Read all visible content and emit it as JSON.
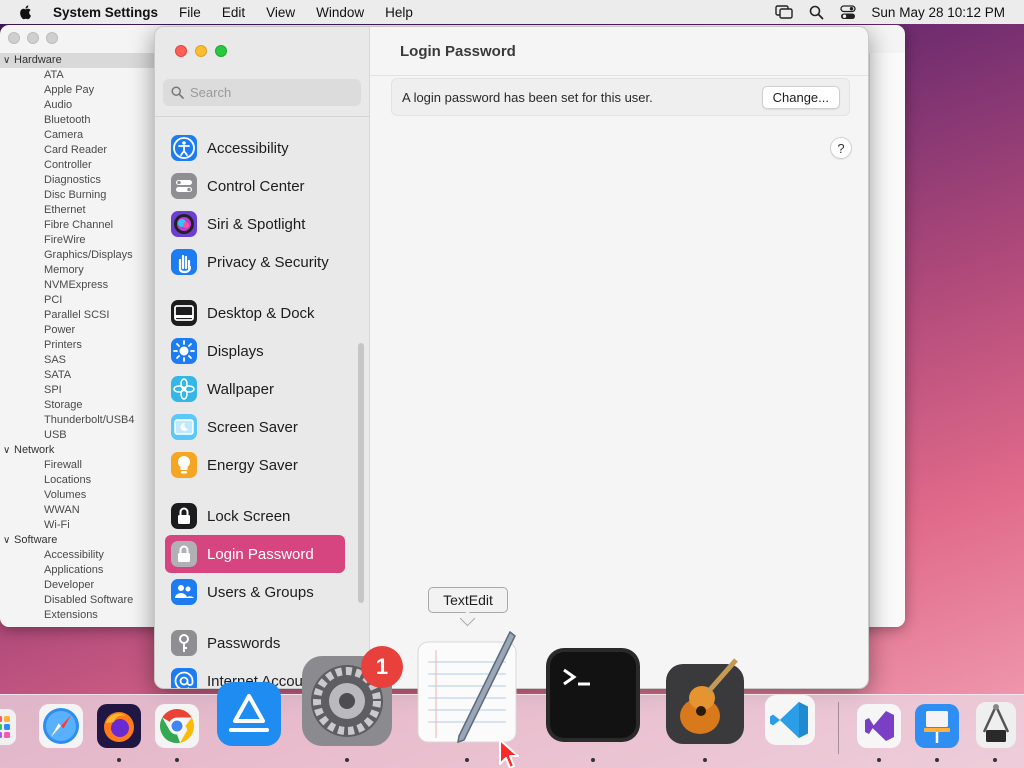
{
  "menubar": {
    "app_name": "System Settings",
    "menus": [
      "File",
      "Edit",
      "View",
      "Window",
      "Help"
    ],
    "clock": "Sun May 28  10:12 PM"
  },
  "sysinfo": {
    "categories": [
      {
        "label": "Hardware",
        "items": [
          "ATA",
          "Apple Pay",
          "Audio",
          "Bluetooth",
          "Camera",
          "Card Reader",
          "Controller",
          "Diagnostics",
          "Disc Burning",
          "Ethernet",
          "Fibre Channel",
          "FireWire",
          "Graphics/Displays",
          "Memory",
          "NVMExpress",
          "PCI",
          "Parallel SCSI",
          "Power",
          "Printers",
          "SAS",
          "SATA",
          "SPI",
          "Storage",
          "Thunderbolt/USB4",
          "USB"
        ]
      },
      {
        "label": "Network",
        "items": [
          "Firewall",
          "Locations",
          "Volumes",
          "WWAN",
          "Wi-Fi"
        ]
      },
      {
        "label": "Software",
        "items": [
          "Accessibility",
          "Applications",
          "Developer",
          "Disabled Software",
          "Extensions"
        ]
      }
    ]
  },
  "settings": {
    "search_placeholder": "Search",
    "sidebar_items": [
      {
        "label": "Accessibility",
        "icon": "accessibility-icon",
        "color": "#1e7cf2"
      },
      {
        "label": "Control Center",
        "icon": "control-center-icon",
        "color": "#8e8e93"
      },
      {
        "label": "Siri & Spotlight",
        "icon": "siri-icon",
        "color": "#6b3fd1"
      },
      {
        "label": "Privacy & Security",
        "icon": "hand-icon",
        "color": "#1e7cf2"
      },
      {
        "label": "Desktop & Dock",
        "icon": "dock-icon",
        "color": "#1c1c1e"
      },
      {
        "label": "Displays",
        "icon": "sun-icon",
        "color": "#1e7cf2"
      },
      {
        "label": "Wallpaper",
        "icon": "flower-icon",
        "color": "#35b6e8"
      },
      {
        "label": "Screen Saver",
        "icon": "screen-saver-icon",
        "color": "#5ac8fa"
      },
      {
        "label": "Energy Saver",
        "icon": "lightbulb-icon",
        "color": "#f5a623"
      },
      {
        "label": "Lock Screen",
        "icon": "lock-icon",
        "color": "#1c1c1e"
      },
      {
        "label": "Login Password",
        "icon": "login-lock-icon",
        "color": "#b0b0b5",
        "selected": true
      },
      {
        "label": "Users & Groups",
        "icon": "users-icon",
        "color": "#1e7cf2"
      },
      {
        "label": "Passwords",
        "icon": "key-icon",
        "color": "#8e8e93"
      },
      {
        "label": "Internet Accou",
        "icon": "at-icon",
        "color": "#1e7cf2"
      }
    ],
    "detail_title": "Login Password",
    "password_message": "A login password has been set for this user.",
    "change_button": "Change...",
    "help_button": "?"
  },
  "tooltip": "TextEdit",
  "dock": {
    "badge_count": "1",
    "apps": [
      {
        "name": "Launchpad",
        "icon": "launchpad-icon"
      },
      {
        "name": "Safari",
        "icon": "safari-icon"
      },
      {
        "name": "Firefox",
        "icon": "firefox-icon"
      },
      {
        "name": "Chrome",
        "icon": "chrome-icon"
      },
      {
        "name": "App Store",
        "icon": "app-store-icon"
      },
      {
        "name": "System Settings",
        "icon": "system-settings-icon"
      },
      {
        "name": "TextEdit",
        "icon": "textedit-icon"
      },
      {
        "name": "Terminal",
        "icon": "terminal-icon"
      },
      {
        "name": "GarageBand",
        "icon": "garageband-icon"
      },
      {
        "name": "Visual Studio Code",
        "icon": "vscode-icon"
      },
      {
        "name": "Visual Studio",
        "icon": "visual-studio-icon"
      },
      {
        "name": "Keynote",
        "icon": "keynote-icon"
      },
      {
        "name": "System Information",
        "icon": "system-information-icon"
      }
    ]
  }
}
